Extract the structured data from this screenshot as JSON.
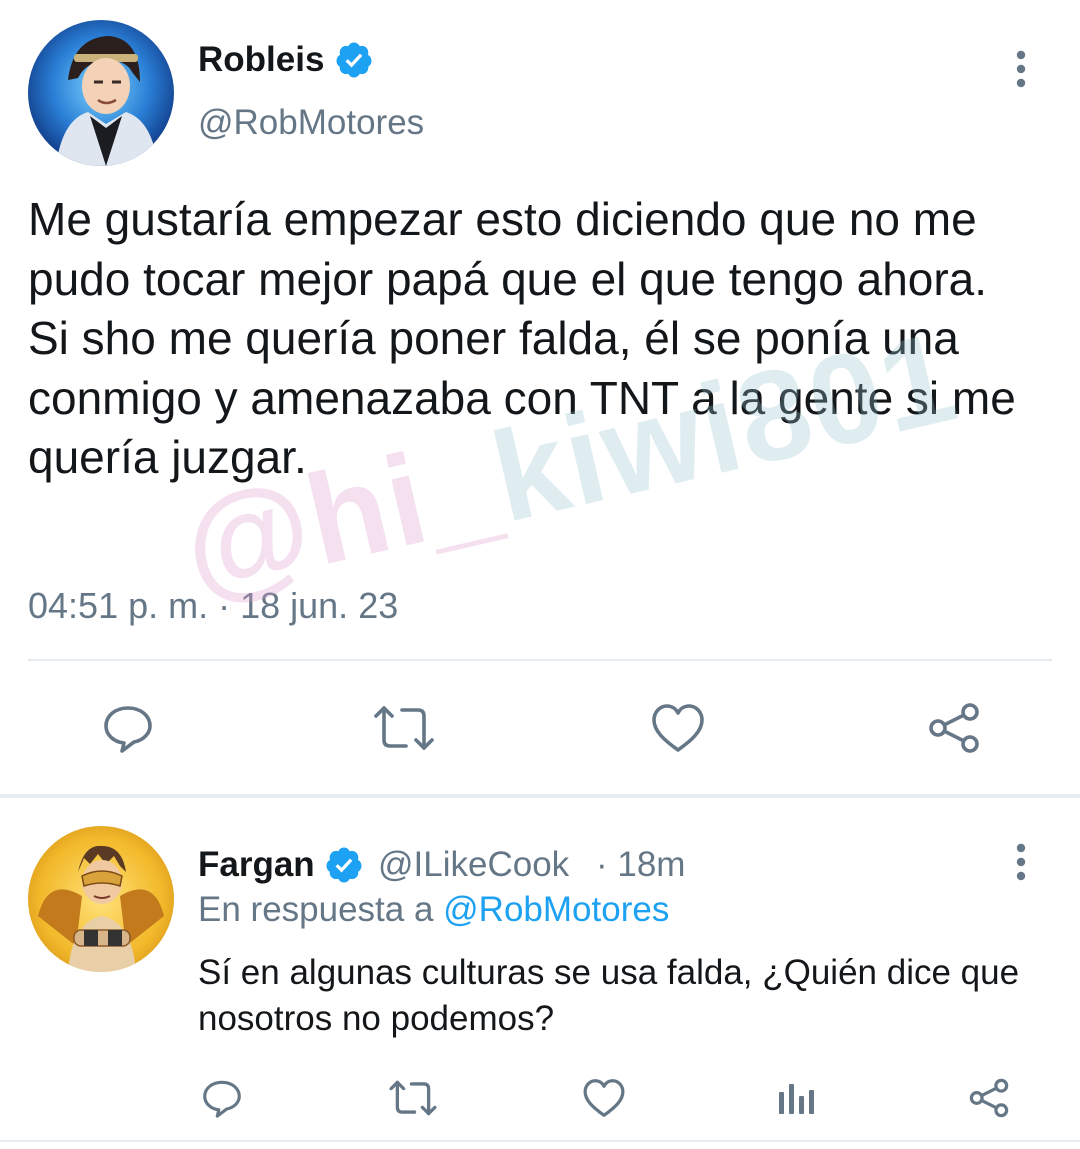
{
  "main_tweet": {
    "author": {
      "display_name": "Robleis",
      "handle": "@RobMotores",
      "verified": true
    },
    "text": "Me gustaría empezar esto diciendo que no me pudo tocar mejor papá que el que tengo ahora.\nSi sho me quería poner falda, él se ponía una conmigo y amenazaba con TNT a la gente si me quería juzgar.",
    "timestamp": "04:51 p. m. · 18 jun. 23",
    "actions": [
      "comment-icon",
      "retweet-icon",
      "like-icon",
      "share-icon"
    ]
  },
  "reply": {
    "author": {
      "display_name": "Fargan",
      "handle": "@ILikeCook",
      "verified": true
    },
    "time_ago": "· 18m",
    "reply_to_prefix": "En respuesta a ",
    "reply_to_handle": "@RobMotores",
    "text": "Sí en algunas culturas se usa falda, ¿Quién dice que nosotros no podemos?",
    "actions": [
      "comment-icon",
      "retweet-icon",
      "like-icon",
      "analytics-icon",
      "share-icon"
    ]
  },
  "watermark": {
    "part_a": "@hi_",
    "part_b": "kiwi801"
  },
  "colors": {
    "text_primary": "#14171a",
    "text_secondary": "#657786",
    "accent": "#1da1f2",
    "divider": "#e6ecf0"
  }
}
